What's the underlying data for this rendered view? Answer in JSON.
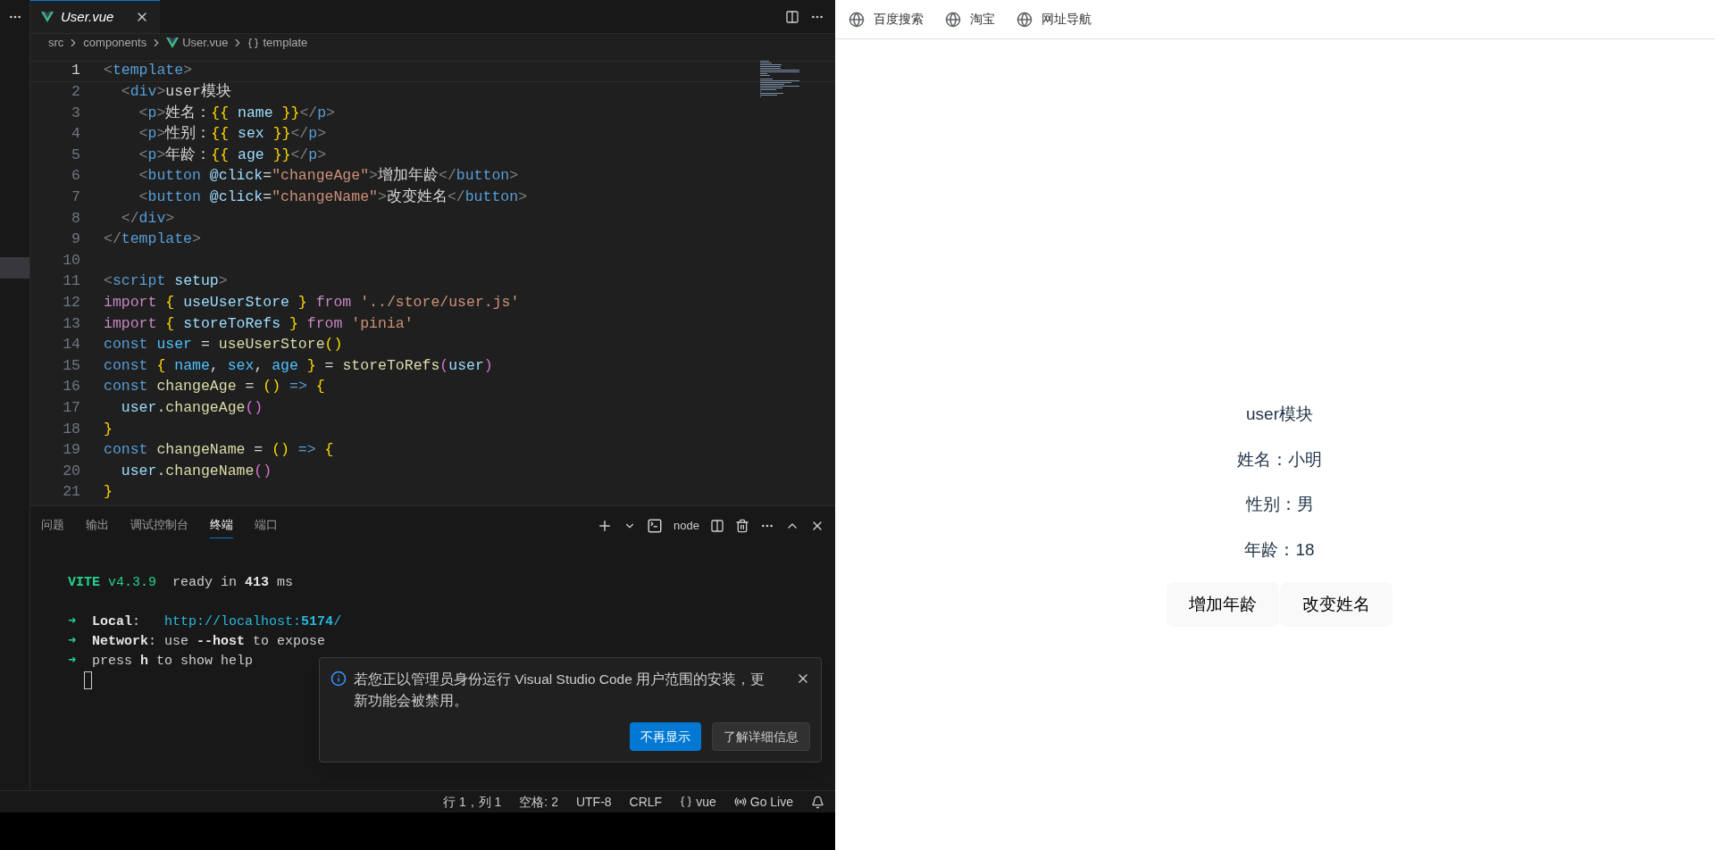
{
  "editor": {
    "tab": {
      "label": "User.vue",
      "selected": true
    },
    "breadcrumb": [
      "src",
      "components",
      "User.vue",
      "template"
    ],
    "lines": [
      {
        "number": "1",
        "current": true,
        "tokens": [
          {
            "text": "<",
            "kind": "punct"
          },
          {
            "text": "template",
            "kind": "tag"
          },
          {
            "text": ">",
            "kind": "punct"
          }
        ]
      },
      {
        "number": "2",
        "current": false,
        "tokens": [
          {
            "text": "  <",
            "kind": "punct"
          },
          {
            "text": "div",
            "kind": "tag"
          },
          {
            "text": ">",
            "kind": "punct"
          },
          {
            "text": "user模块",
            "kind": "plain"
          }
        ]
      },
      {
        "number": "3",
        "current": false,
        "tokens": [
          {
            "text": "    <",
            "kind": "punct"
          },
          {
            "text": "p",
            "kind": "tag"
          },
          {
            "text": ">",
            "kind": "punct"
          },
          {
            "text": "姓名：",
            "kind": "plain"
          },
          {
            "text": "{{",
            "kind": "brace"
          },
          {
            "text": " name ",
            "kind": "var"
          },
          {
            "text": "}}",
            "kind": "brace"
          },
          {
            "text": "</",
            "kind": "punct"
          },
          {
            "text": "p",
            "kind": "tag"
          },
          {
            "text": ">",
            "kind": "punct"
          }
        ]
      },
      {
        "number": "4",
        "current": false,
        "tokens": [
          {
            "text": "    <",
            "kind": "punct"
          },
          {
            "text": "p",
            "kind": "tag"
          },
          {
            "text": ">",
            "kind": "punct"
          },
          {
            "text": "性别：",
            "kind": "plain"
          },
          {
            "text": "{{",
            "kind": "brace"
          },
          {
            "text": " sex ",
            "kind": "var"
          },
          {
            "text": "}}",
            "kind": "brace"
          },
          {
            "text": "</",
            "kind": "punct"
          },
          {
            "text": "p",
            "kind": "tag"
          },
          {
            "text": ">",
            "kind": "punct"
          }
        ]
      },
      {
        "number": "5",
        "current": false,
        "tokens": [
          {
            "text": "    <",
            "kind": "punct"
          },
          {
            "text": "p",
            "kind": "tag"
          },
          {
            "text": ">",
            "kind": "punct"
          },
          {
            "text": "年龄：",
            "kind": "plain"
          },
          {
            "text": "{{",
            "kind": "brace"
          },
          {
            "text": " age ",
            "kind": "var"
          },
          {
            "text": "}}",
            "kind": "brace"
          },
          {
            "text": "</",
            "kind": "punct"
          },
          {
            "text": "p",
            "kind": "tag"
          },
          {
            "text": ">",
            "kind": "punct"
          }
        ]
      },
      {
        "number": "6",
        "current": false,
        "tokens": [
          {
            "text": "    <",
            "kind": "punct"
          },
          {
            "text": "button",
            "kind": "tag"
          },
          {
            "text": " @click",
            "kind": "var"
          },
          {
            "text": "=",
            "kind": "plain"
          },
          {
            "text": "\"changeAge\"",
            "kind": "string"
          },
          {
            "text": ">",
            "kind": "punct"
          },
          {
            "text": "增加年龄",
            "kind": "plain"
          },
          {
            "text": "</",
            "kind": "punct"
          },
          {
            "text": "button",
            "kind": "tag"
          },
          {
            "text": ">",
            "kind": "punct"
          }
        ]
      },
      {
        "number": "7",
        "current": false,
        "tokens": [
          {
            "text": "    <",
            "kind": "punct"
          },
          {
            "text": "button",
            "kind": "tag"
          },
          {
            "text": " @click",
            "kind": "var"
          },
          {
            "text": "=",
            "kind": "plain"
          },
          {
            "text": "\"changeName\"",
            "kind": "string"
          },
          {
            "text": ">",
            "kind": "punct"
          },
          {
            "text": "改变姓名",
            "kind": "plain"
          },
          {
            "text": "</",
            "kind": "punct"
          },
          {
            "text": "button",
            "kind": "tag"
          },
          {
            "text": ">",
            "kind": "punct"
          }
        ]
      },
      {
        "number": "8",
        "current": false,
        "tokens": [
          {
            "text": "  </",
            "kind": "punct"
          },
          {
            "text": "div",
            "kind": "tag"
          },
          {
            "text": ">",
            "kind": "punct"
          }
        ]
      },
      {
        "number": "9",
        "current": false,
        "tokens": [
          {
            "text": "</",
            "kind": "punct"
          },
          {
            "text": "template",
            "kind": "tag"
          },
          {
            "text": ">",
            "kind": "punct"
          }
        ]
      },
      {
        "number": "10",
        "current": false
      },
      {
        "number": "11",
        "current": false,
        "tokens": [
          {
            "text": "<",
            "kind": "punct"
          },
          {
            "text": "script",
            "kind": "tag"
          },
          {
            "text": " setup",
            "kind": "var"
          },
          {
            "text": ">",
            "kind": "punct"
          }
        ]
      },
      {
        "number": "12",
        "current": false,
        "tokens": [
          {
            "text": "import",
            "kind": "keyword"
          },
          {
            "text": " {",
            "kind": "brace"
          },
          {
            "text": " useUserStore ",
            "kind": "var"
          },
          {
            "text": "}",
            "kind": "brace"
          },
          {
            "text": " from",
            "kind": "keyword"
          },
          {
            "text": " '../store/user.js'",
            "kind": "string"
          }
        ]
      },
      {
        "number": "13",
        "current": false,
        "tokens": [
          {
            "text": "import",
            "kind": "keyword"
          },
          {
            "text": " {",
            "kind": "brace"
          },
          {
            "text": " storeToRefs ",
            "kind": "var"
          },
          {
            "text": "}",
            "kind": "brace"
          },
          {
            "text": " from",
            "kind": "keyword"
          },
          {
            "text": " 'pinia'",
            "kind": "string"
          }
        ]
      },
      {
        "number": "14",
        "current": false,
        "tokens": [
          {
            "text": "const",
            "kind": "tag"
          },
          {
            "text": " user",
            "kind": "const"
          },
          {
            "text": " = ",
            "kind": "plain"
          },
          {
            "text": "useUserStore",
            "kind": "func"
          },
          {
            "text": "()",
            "kind": "brace"
          }
        ]
      },
      {
        "number": "15",
        "current": false,
        "tokens": [
          {
            "text": "const",
            "kind": "tag"
          },
          {
            "text": " {",
            "kind": "brace"
          },
          {
            "text": " name",
            "kind": "const"
          },
          {
            "text": ", ",
            "kind": "plain"
          },
          {
            "text": "sex",
            "kind": "const"
          },
          {
            "text": ", ",
            "kind": "plain"
          },
          {
            "text": "age ",
            "kind": "const"
          },
          {
            "text": "}",
            "kind": "brace"
          },
          {
            "text": " = ",
            "kind": "plain"
          },
          {
            "text": "storeToRefs",
            "kind": "func"
          },
          {
            "text": "(",
            "kind": "paren"
          },
          {
            "text": "user",
            "kind": "var"
          },
          {
            "text": ")",
            "kind": "paren"
          }
        ]
      },
      {
        "number": "16",
        "current": false,
        "tokens": [
          {
            "text": "const",
            "kind": "tag"
          },
          {
            "text": " changeAge",
            "kind": "func"
          },
          {
            "text": " = ",
            "kind": "plain"
          },
          {
            "text": "()",
            "kind": "brace"
          },
          {
            "text": " => ",
            "kind": "tag"
          },
          {
            "text": "{",
            "kind": "brace"
          }
        ]
      },
      {
        "number": "17",
        "current": false,
        "tokens": [
          {
            "text": "  user",
            "kind": "var"
          },
          {
            "text": ".",
            "kind": "plain"
          },
          {
            "text": "changeAge",
            "kind": "func"
          },
          {
            "text": "()",
            "kind": "paren"
          }
        ]
      },
      {
        "number": "18",
        "current": false,
        "tokens": [
          {
            "text": "}",
            "kind": "brace"
          }
        ]
      },
      {
        "number": "19",
        "current": false,
        "tokens": [
          {
            "text": "const",
            "kind": "tag"
          },
          {
            "text": " changeName",
            "kind": "func"
          },
          {
            "text": " = ",
            "kind": "plain"
          },
          {
            "text": "()",
            "kind": "brace"
          },
          {
            "text": " => ",
            "kind": "tag"
          },
          {
            "text": "{",
            "kind": "brace"
          }
        ]
      },
      {
        "number": "20",
        "current": false,
        "tokens": [
          {
            "text": "  user",
            "kind": "var"
          },
          {
            "text": ".",
            "kind": "plain"
          },
          {
            "text": "changeName",
            "kind": "func"
          },
          {
            "text": "()",
            "kind": "paren"
          }
        ]
      },
      {
        "number": "21",
        "current": false,
        "tokens": [
          {
            "text": "}",
            "kind": "brace"
          }
        ]
      }
    ]
  },
  "panel": {
    "tabs": [
      {
        "label": "问题",
        "selected": false
      },
      {
        "label": "输出",
        "selected": false
      },
      {
        "label": "调试控制台",
        "selected": false
      },
      {
        "label": "终端",
        "selected": true
      },
      {
        "label": "端口",
        "selected": false
      }
    ],
    "terminal_name": "node",
    "terminal_blocks": [
      [
        {
          "tokens": [
            {
              "text": "  VITE",
              "kind": "green-bold"
            },
            {
              "text": " v4.3.9",
              "kind": "green"
            },
            {
              "text": "  ready in ",
              "kind": "plain"
            },
            {
              "text": "413",
              "kind": "bold"
            },
            {
              "text": " ms",
              "kind": "plain"
            }
          ]
        }
      ],
      [
        {
          "tokens": [
            {
              "text": "  ➜",
              "kind": "green"
            },
            {
              "text": "  Local",
              "kind": "bold"
            },
            {
              "text": ":   ",
              "kind": "plain"
            },
            {
              "text": "http://localhost:",
              "kind": "link"
            },
            {
              "text": "5174",
              "kind": "link-bold"
            },
            {
              "text": "/",
              "kind": "link"
            }
          ]
        },
        {
          "tokens": [
            {
              "text": "  ➜",
              "kind": "green"
            },
            {
              "text": "  Network",
              "kind": "bold"
            },
            {
              "text": ": use ",
              "kind": "plain"
            },
            {
              "text": "--host",
              "kind": "bold"
            },
            {
              "text": " to expose",
              "kind": "plain"
            }
          ]
        },
        {
          "tokens": [
            {
              "text": "  ➜",
              "kind": "green"
            },
            {
              "text": "  press ",
              "kind": "plain"
            },
            {
              "text": "h",
              "kind": "bold"
            },
            {
              "text": " to show help",
              "kind": "plain"
            }
          ]
        }
      ]
    ]
  },
  "notification": {
    "message": "若您正以管理员身份运行 Visual Studio Code 用户范围的安装，更新功能会被禁用。",
    "buttons": [
      {
        "label": "不再显示",
        "kind": "primary"
      },
      {
        "label": "了解详细信息",
        "kind": "secondary"
      }
    ]
  },
  "status_bar": {
    "items": [
      "行 1，列 1",
      "空格: 2",
      "UTF-8",
      "CRLF",
      "vue",
      "Go Live"
    ]
  },
  "browser": {
    "bookmarks": [
      "百度搜索",
      "淘宝",
      "网址导航"
    ],
    "page": {
      "title": "user模块",
      "lines": [
        "姓名：小明",
        "性别：男",
        "年龄：18"
      ],
      "buttons": [
        "增加年龄",
        "改变姓名"
      ]
    }
  }
}
